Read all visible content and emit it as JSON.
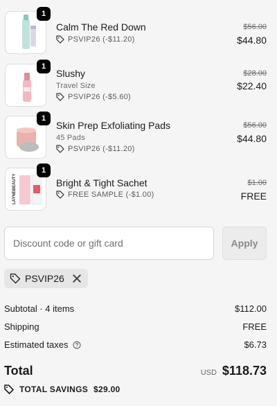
{
  "items": [
    {
      "quantity": "1",
      "name": "Calm The Red Down",
      "variant": "",
      "discount": "PSVIP26 (-$11.20)",
      "original_price": "$56.00",
      "final_price": "$44.80",
      "thumb": "serum-bottle"
    },
    {
      "quantity": "1",
      "name": "Slushy",
      "variant": "Travel Size",
      "discount": "PSVIP26 (-$5.60)",
      "original_price": "$28.00",
      "final_price": "$22.40",
      "thumb": "pink-bottle"
    },
    {
      "quantity": "1",
      "name": "Skin Prep Exfoliating Pads",
      "variant": "45 Pads",
      "discount": "PSVIP26 (-$11.20)",
      "original_price": "$56.00",
      "final_price": "$44.80",
      "thumb": "pad-jar"
    },
    {
      "quantity": "1",
      "name": "Bright & Tight Sachet",
      "variant": "",
      "discount": "FREE SAMPLE (-$1.00)",
      "original_price": "$1.00",
      "final_price": "FREE",
      "thumb": "sachet",
      "sachet_brand": "LAYNEBEAUTY"
    }
  ],
  "discount_form": {
    "placeholder": "Discount code or gift card",
    "apply_label": "Apply"
  },
  "applied_code": {
    "label": "PSVIP26"
  },
  "summary": {
    "subtotal_label": "Subtotal · 4 items",
    "subtotal_value": "$112.00",
    "shipping_label": "Shipping",
    "shipping_value": "FREE",
    "taxes_label": "Estimated taxes",
    "taxes_value": "$6.73"
  },
  "total": {
    "label": "Total",
    "currency": "USD",
    "amount": "$118.73"
  },
  "savings": {
    "label": "TOTAL SAVINGS",
    "amount": "$29.00"
  },
  "icons": {
    "tag": "tag-icon",
    "close": "close-icon",
    "help": "help-circle-icon",
    "savings_tag": "tag-filled-icon"
  },
  "colors": {
    "background": "#f5f5f5",
    "quantity_badge": "#000000",
    "chip_bg": "#e6e6e6",
    "apply_button_bg": "#ececec"
  }
}
